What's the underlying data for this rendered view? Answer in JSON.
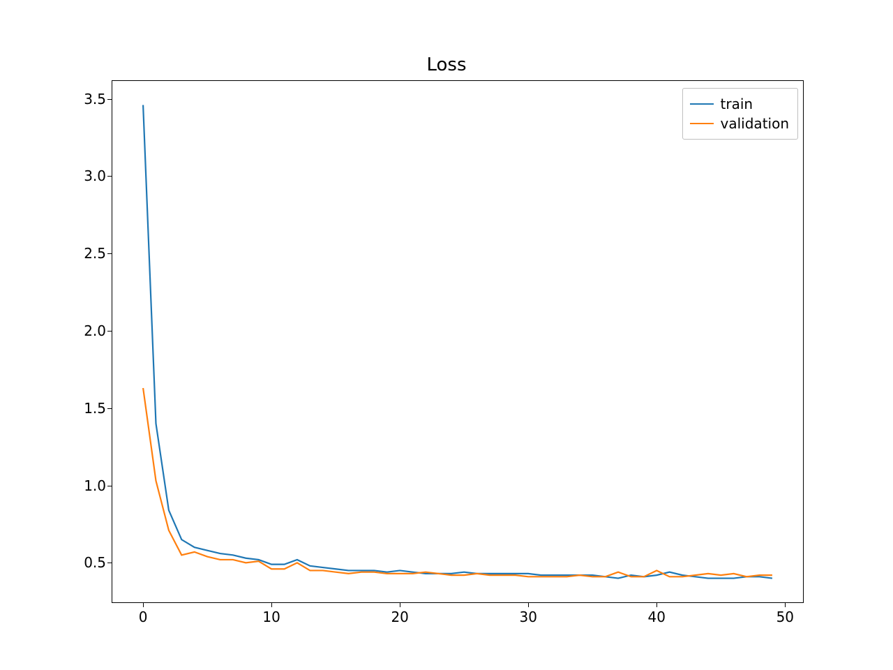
{
  "chart_data": {
    "type": "line",
    "title": "Loss",
    "xlabel": "",
    "ylabel": "",
    "xlim": [
      -2.45,
      51.45
    ],
    "ylim": [
      0.24,
      3.62
    ],
    "x_ticks": [
      0,
      10,
      20,
      30,
      40,
      50
    ],
    "y_ticks": [
      0.5,
      1.0,
      1.5,
      2.0,
      2.5,
      3.0,
      3.5
    ],
    "x": [
      0,
      1,
      2,
      3,
      4,
      5,
      6,
      7,
      8,
      9,
      10,
      11,
      12,
      13,
      14,
      15,
      16,
      17,
      18,
      19,
      20,
      21,
      22,
      23,
      24,
      25,
      26,
      27,
      28,
      29,
      30,
      31,
      32,
      33,
      34,
      35,
      36,
      37,
      38,
      39,
      40,
      41,
      42,
      43,
      44,
      45,
      46,
      47,
      48,
      49
    ],
    "series": [
      {
        "name": "train",
        "color": "#1f77b4",
        "values": [
          3.46,
          1.4,
          0.84,
          0.65,
          0.6,
          0.58,
          0.56,
          0.55,
          0.53,
          0.52,
          0.49,
          0.49,
          0.52,
          0.48,
          0.47,
          0.46,
          0.45,
          0.45,
          0.45,
          0.44,
          0.45,
          0.44,
          0.43,
          0.43,
          0.43,
          0.44,
          0.43,
          0.43,
          0.43,
          0.43,
          0.43,
          0.42,
          0.42,
          0.42,
          0.42,
          0.42,
          0.41,
          0.4,
          0.42,
          0.41,
          0.42,
          0.44,
          0.42,
          0.41,
          0.4,
          0.4,
          0.4,
          0.41,
          0.41,
          0.4
        ]
      },
      {
        "name": "validation",
        "color": "#ff7f0e",
        "values": [
          1.63,
          1.03,
          0.71,
          0.55,
          0.57,
          0.54,
          0.52,
          0.52,
          0.5,
          0.51,
          0.46,
          0.46,
          0.5,
          0.45,
          0.45,
          0.44,
          0.43,
          0.44,
          0.44,
          0.43,
          0.43,
          0.43,
          0.44,
          0.43,
          0.42,
          0.42,
          0.43,
          0.42,
          0.42,
          0.42,
          0.41,
          0.41,
          0.41,
          0.41,
          0.42,
          0.41,
          0.41,
          0.44,
          0.41,
          0.41,
          0.45,
          0.41,
          0.41,
          0.42,
          0.43,
          0.42,
          0.43,
          0.41,
          0.42,
          0.42
        ]
      }
    ],
    "legend": {
      "position": "upper right",
      "entries": [
        "train",
        "validation"
      ]
    },
    "grid": false
  }
}
